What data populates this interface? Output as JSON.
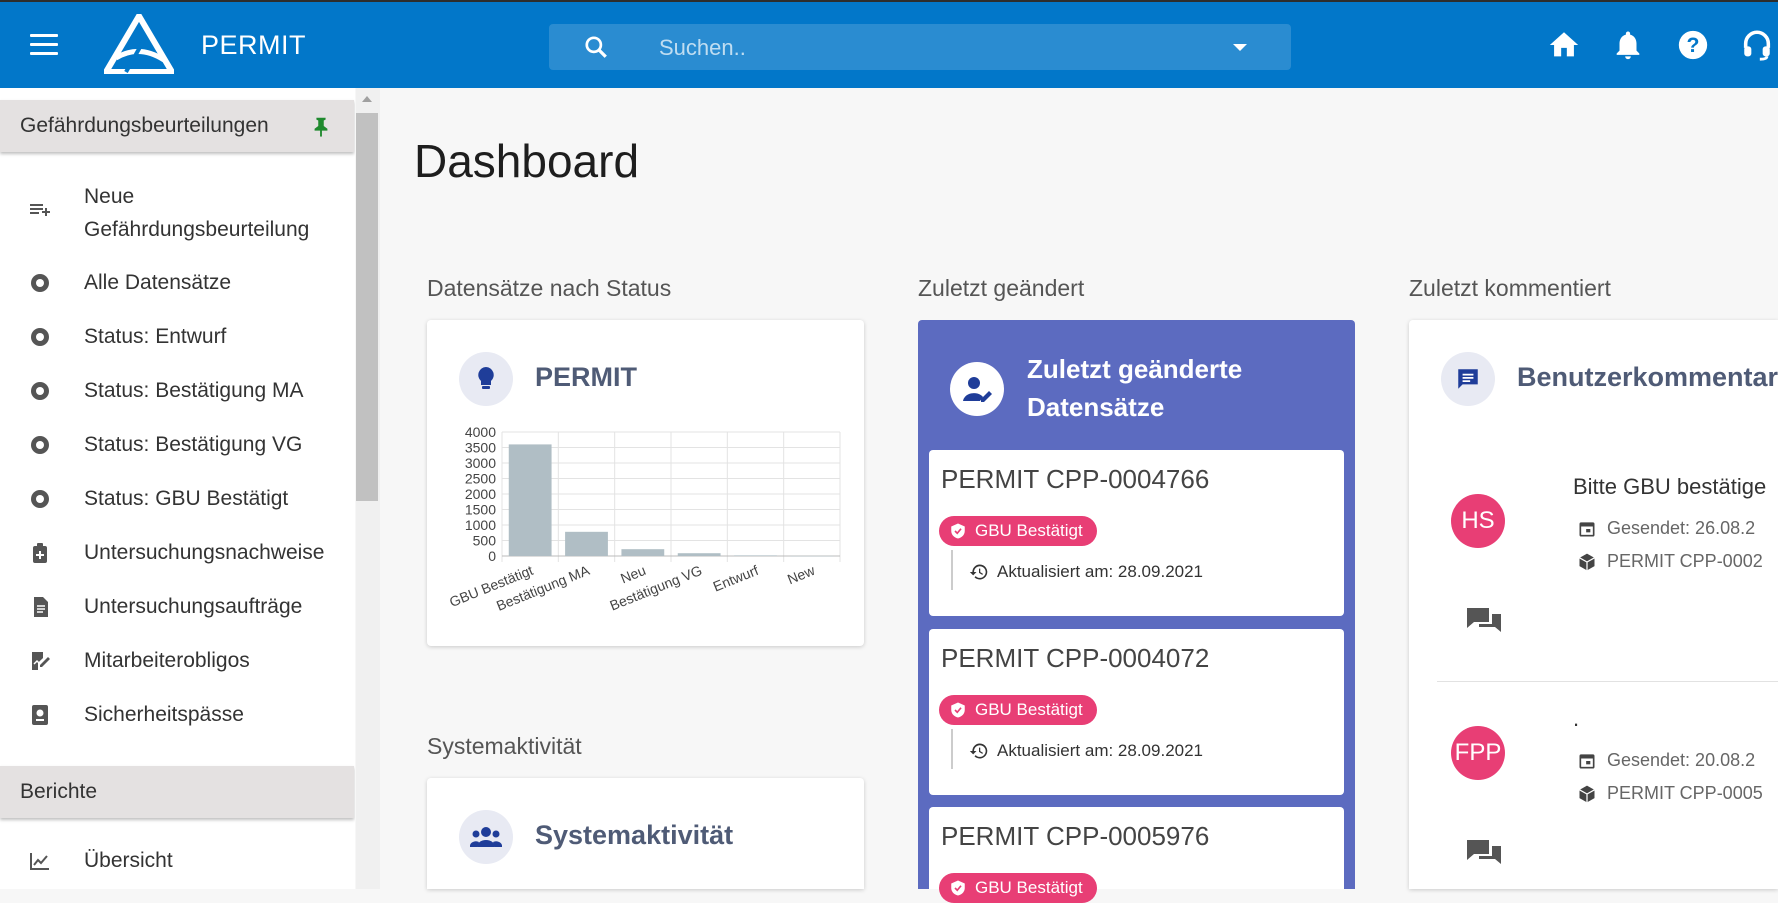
{
  "header": {
    "app_title": "PERMIT",
    "search_placeholder": "Suchen..",
    "icons": [
      "menu-icon",
      "home-icon",
      "bell-icon",
      "help-icon",
      "headset-icon"
    ]
  },
  "sidebar": {
    "section1": "Gefährdungsbeurteilungen",
    "items": [
      {
        "label": "Neue Gefährdungsbeurteilung",
        "icon": "playlist-add-icon"
      },
      {
        "label": "Alle Datensätze",
        "icon": "radio-icon"
      },
      {
        "label": "Status: Entwurf",
        "icon": "radio-icon"
      },
      {
        "label": "Status: Bestätigung MA",
        "icon": "radio-icon"
      },
      {
        "label": "Status: Bestätigung VG",
        "icon": "radio-icon"
      },
      {
        "label": "Status: GBU Bestätigt",
        "icon": "radio-icon"
      },
      {
        "label": "Untersuchungsnachweise",
        "icon": "medical-icon"
      },
      {
        "label": "Untersuchungsaufträge",
        "icon": "document-icon"
      },
      {
        "label": "Mitarbeiterobligos",
        "icon": "edit-chart-icon"
      },
      {
        "label": "Sicherheitspässe",
        "icon": "passport-icon"
      }
    ],
    "section2": "Berichte",
    "items2": [
      {
        "label": "Übersicht",
        "icon": "chart-icon"
      }
    ]
  },
  "main": {
    "page_title": "Dashboard",
    "col1_title": "Datensätze nach Status",
    "col2_title": "Zuletzt geändert",
    "col3_title": "Zuletzt kommentiert",
    "chart_card_title": "PERMIT",
    "activity_section_title": "Systemaktivität",
    "activity_card_title": "Systemaktivität",
    "recent_card_title": "Zuletzt geänderte Datensätze",
    "records": [
      {
        "id": "PERMIT CPP-0004766",
        "badge": "GBU Bestätigt",
        "updated": "Aktualisiert am: 28.09.2021"
      },
      {
        "id": "PERMIT CPP-0004072",
        "badge": "GBU Bestätigt",
        "updated": "Aktualisiert am: 28.09.2021"
      },
      {
        "id": "PERMIT CPP-0005976",
        "badge": "GBU Bestätigt",
        "updated": ""
      }
    ],
    "comments_card_title": "Benutzerkommentar",
    "comments": [
      {
        "initials": "HS",
        "text": "Bitte GBU bestätige",
        "sent": "Gesendet: 26.08.2",
        "ref": "PERMIT CPP-0002"
      },
      {
        "initials": "FPP",
        "text": ".",
        "sent": "Gesendet: 20.08.2",
        "ref": "PERMIT CPP-0005"
      }
    ]
  },
  "colors": {
    "topbar": "#0277c9",
    "accent": "#5c6bc0",
    "badge": "#e83e75",
    "bars": "#b0bec5"
  },
  "chart_data": {
    "type": "bar",
    "categories": [
      "GBU Bestätigt",
      "Bestätigung MA",
      "Neu",
      "Bestätigung VG",
      "Entwurf",
      "New"
    ],
    "values": [
      3600,
      780,
      220,
      90,
      20,
      5
    ],
    "ylim": [
      0,
      4000
    ],
    "yticks": [
      0,
      500,
      1000,
      1500,
      2000,
      2500,
      3000,
      3500,
      4000
    ],
    "grid": true
  }
}
